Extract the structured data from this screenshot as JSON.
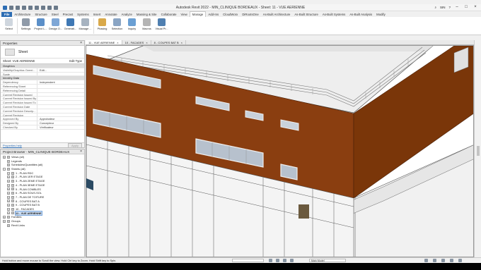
{
  "app": {
    "title": "Autodesk Revit 2022 - MIN_CLINIQUE BORDEAUX - Sheet: 11 - VUE AERIENNE",
    "user": "SIN"
  },
  "ribbon_tabs": [
    {
      "label": "File",
      "active": false,
      "file": true
    },
    {
      "label": "Architecture"
    },
    {
      "label": "Structure"
    },
    {
      "label": "Steel"
    },
    {
      "label": "Precast"
    },
    {
      "label": "Systems"
    },
    {
      "label": "Insert"
    },
    {
      "label": "Annotate"
    },
    {
      "label": "Analyze"
    },
    {
      "label": "Massing & Site"
    },
    {
      "label": "Collaborate"
    },
    {
      "label": "View"
    },
    {
      "label": "Manage",
      "active": true
    },
    {
      "label": "Add-Ins"
    },
    {
      "label": "CloudWorx"
    },
    {
      "label": "DiRootsOne"
    },
    {
      "label": "As-Built Architecture"
    },
    {
      "label": "As-Built Structure"
    },
    {
      "label": "As-Built Systems"
    },
    {
      "label": "As-Built Analysis"
    },
    {
      "label": "Modify"
    }
  ],
  "ribbon_buttons": [
    {
      "label": "Select",
      "icon": "cursor-icon",
      "color": "#cfd6de",
      "sep_after": true
    },
    {
      "label": "Settings",
      "icon": "gear-icon",
      "color": "#8f9aa8"
    },
    {
      "label": "Project L...",
      "icon": "location-icon",
      "color": "#5b8fc8"
    },
    {
      "label": "Design O...",
      "icon": "design-options-icon",
      "color": "#7fa7d6"
    },
    {
      "label": "Generati...",
      "icon": "generative-design-icon",
      "color": "#3f78b4"
    },
    {
      "label": "Manage ...",
      "icon": "manage-project-icon",
      "color": "#a7b3c0",
      "sep_after": true
    },
    {
      "label": "Phasing",
      "icon": "phasing-icon",
      "color": "#d9a94a"
    },
    {
      "label": "Selection",
      "icon": "selection-icon",
      "color": "#8aa5c4"
    },
    {
      "label": "Inquiry",
      "icon": "inquiry-icon",
      "color": "#6a9fd3"
    },
    {
      "label": "Macros",
      "icon": "macros-icon",
      "color": "#b5b5b5"
    },
    {
      "label": "Visual Pr...",
      "icon": "visual-programming-icon",
      "color": "#4f7fb0"
    }
  ],
  "properties": {
    "title": "Properties",
    "type_name": "Sheet",
    "view_selector": "Sheet: VUE AERIENNE",
    "edit_type": "Edit Type",
    "rows": [
      {
        "group": true,
        "label": "Graphics"
      },
      {
        "label": "Visibility/Graphics Overri...",
        "value": "Edit..."
      },
      {
        "label": "Scale",
        "value": ""
      },
      {
        "group": true,
        "label": "Identity Data"
      },
      {
        "label": "Dependency",
        "value": "Independent"
      },
      {
        "label": "Referencing Sheet",
        "value": ""
      },
      {
        "label": "Referencing Detail",
        "value": ""
      },
      {
        "label": "Current Revision Issued",
        "value": ""
      },
      {
        "label": "Current Revision Issued By",
        "value": ""
      },
      {
        "label": "Current Revision Issued To",
        "value": ""
      },
      {
        "label": "Current Revision Date",
        "value": ""
      },
      {
        "label": "Current Revision Descrip...",
        "value": ""
      },
      {
        "label": "Current Revision",
        "value": ""
      },
      {
        "label": "Approved By",
        "value": "Approbateur"
      },
      {
        "label": "Designed By",
        "value": "Concepteur"
      },
      {
        "label": "Checked By",
        "value": "Vérificateur"
      }
    ],
    "help_link": "Properties help",
    "apply": "Apply"
  },
  "project_browser": {
    "title": "Project Browser - MIN_CLINIQUE BORDEAUX",
    "nodes": [
      {
        "label": "Views (all)",
        "level": 0,
        "toggle": "+"
      },
      {
        "label": "Legends",
        "level": 0,
        "toggle": ""
      },
      {
        "label": "Schedules/Quantities (all)",
        "level": 0,
        "toggle": ""
      },
      {
        "label": "Sheets (all)",
        "level": 0,
        "toggle": "-"
      },
      {
        "label": "1 - PLAN RDC",
        "level": 1,
        "toggle": "+"
      },
      {
        "label": "2 - PLAN 1ER ETAGE",
        "level": 1,
        "toggle": "+"
      },
      {
        "label": "3 - PLAN 2EME ETAGE",
        "level": 1,
        "toggle": "+"
      },
      {
        "label": "4 - PLAN 3EME ETAGE",
        "level": 1,
        "toggle": "+"
      },
      {
        "label": "5 - PLAN COMBLES",
        "level": 1,
        "toggle": "+"
      },
      {
        "label": "6 - PLAN SOUS-SOL",
        "level": 1,
        "toggle": "+"
      },
      {
        "label": "7 - PLAN DE TOITURE",
        "level": 1,
        "toggle": "+"
      },
      {
        "label": "8 - COUPES BAT A",
        "level": 1,
        "toggle": "+"
      },
      {
        "label": "9 - COUPES BAT B",
        "level": 1,
        "toggle": "+"
      },
      {
        "label": "10 - FACADES",
        "level": 1,
        "toggle": "+"
      },
      {
        "label": "11 - VUE AERIENNE",
        "level": 1,
        "toggle": "+",
        "selected": true
      },
      {
        "label": "Families",
        "level": 0,
        "toggle": "+"
      },
      {
        "label": "Groups",
        "level": 0,
        "toggle": "+"
      },
      {
        "label": "Revit Links",
        "level": 0,
        "toggle": ""
      }
    ]
  },
  "view_tabs": [
    {
      "label": "11 - VUE AERIENNE",
      "active": true
    },
    {
      "label": "10 - FACADES",
      "active": false
    },
    {
      "label": "8 - COUPES BAT B",
      "active": false
    }
  ],
  "status_bar": {
    "message": "Hold button and move mouse to Scroll the view. Hold Ctrl key to Zoom. Hold Shift key to Spin.",
    "model": "Main Model"
  },
  "colors": {
    "facade": "#8a3e10",
    "facade_dark": "#7a3609",
    "accent": "#2d6db3"
  }
}
